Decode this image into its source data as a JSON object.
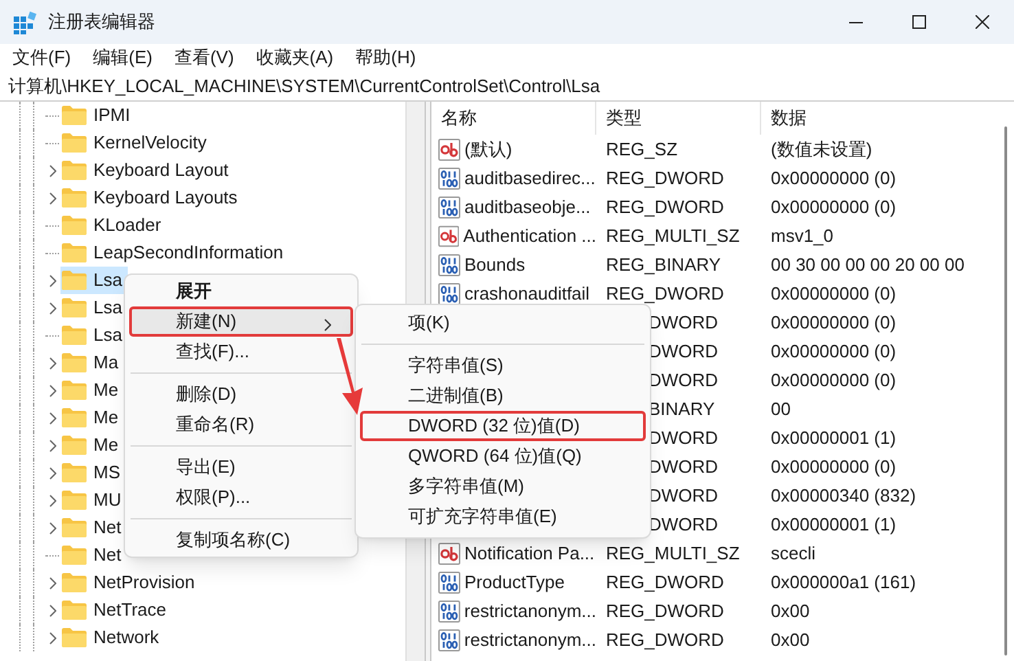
{
  "window": {
    "title": "注册表编辑器"
  },
  "menu_bar": [
    "文件(F)",
    "编辑(E)",
    "查看(V)",
    "收藏夹(A)",
    "帮助(H)"
  ],
  "address_bar": {
    "value": "计算机\\HKEY_LOCAL_MACHINE\\SYSTEM\\CurrentControlSet\\Control\\Lsa"
  },
  "tree": [
    {
      "label": "IPMI",
      "has_children": false,
      "selected": false
    },
    {
      "label": "KernelVelocity",
      "has_children": false,
      "selected": false
    },
    {
      "label": "Keyboard Layout",
      "has_children": true,
      "selected": false
    },
    {
      "label": "Keyboard Layouts",
      "has_children": true,
      "selected": false
    },
    {
      "label": "KLoader",
      "has_children": false,
      "selected": false
    },
    {
      "label": "LeapSecondInformation",
      "has_children": false,
      "selected": false
    },
    {
      "label": "Lsa",
      "has_children": true,
      "selected": true
    },
    {
      "label": "Lsa",
      "has_children": true,
      "selected": false
    },
    {
      "label": "Lsa",
      "has_children": false,
      "selected": false
    },
    {
      "label": "Ma",
      "has_children": true,
      "selected": false
    },
    {
      "label": "Me",
      "has_children": true,
      "selected": false
    },
    {
      "label": "Me",
      "has_children": true,
      "selected": false
    },
    {
      "label": "Me",
      "has_children": true,
      "selected": false
    },
    {
      "label": "MS",
      "has_children": true,
      "selected": false
    },
    {
      "label": "MU",
      "has_children": true,
      "selected": false
    },
    {
      "label": "Net",
      "has_children": true,
      "selected": false
    },
    {
      "label": "Net",
      "has_children": false,
      "selected": false
    },
    {
      "label": "NetProvision",
      "has_children": true,
      "selected": false
    },
    {
      "label": "NetTrace",
      "has_children": true,
      "selected": false
    },
    {
      "label": "Network",
      "has_children": true,
      "selected": false
    }
  ],
  "table": {
    "columns": [
      "名称",
      "类型",
      "数据"
    ],
    "rows": [
      {
        "kind": "string",
        "name": "(默认)",
        "type": "REG_SZ",
        "data": "(数值未设置)"
      },
      {
        "kind": "binary",
        "name": "auditbasedirec...",
        "type": "REG_DWORD",
        "data": "0x00000000 (0)"
      },
      {
        "kind": "binary",
        "name": "auditbaseobje...",
        "type": "REG_DWORD",
        "data": "0x00000000 (0)"
      },
      {
        "kind": "string",
        "name": "Authentication ...",
        "type": "REG_MULTI_SZ",
        "data": "msv1_0"
      },
      {
        "kind": "binary",
        "name": "Bounds",
        "type": "REG_BINARY",
        "data": "00 30 00 00 00 20 00 00"
      },
      {
        "kind": "binary",
        "name": "crashonauditfail",
        "type": "REG_DWORD",
        "data": "0x00000000 (0)"
      },
      {
        "kind": "covered",
        "type": "DWORD",
        "data": "0x00000000 (0)"
      },
      {
        "kind": "covered",
        "type": "DWORD",
        "data": "0x00000000 (0)"
      },
      {
        "kind": "covered",
        "type": "DWORD",
        "data": "0x00000000 (0)"
      },
      {
        "kind": "covered",
        "type": "BINARY",
        "data": "00"
      },
      {
        "kind": "covered",
        "type": "DWORD",
        "data": "0x00000001 (1)"
      },
      {
        "kind": "covered",
        "type": "DWORD",
        "data": "0x00000000 (0)"
      },
      {
        "kind": "covered",
        "type": "DWORD",
        "data": "0x00000340 (832)"
      },
      {
        "kind": "covered",
        "type": "DWORD",
        "data": "0x00000001 (1)"
      },
      {
        "kind": "string",
        "name": "Notification Pa...",
        "type": "REG_MULTI_SZ",
        "data": "scecli"
      },
      {
        "kind": "binary",
        "name": "ProductType",
        "type": "REG_DWORD",
        "data": "0x000000a1 (161)"
      },
      {
        "kind": "binary",
        "name": "restrictanonym...",
        "type": "REG_DWORD",
        "data": "0x00"
      },
      {
        "kind": "binary",
        "name": "restrictanonym...",
        "type": "REG_DWORD",
        "data": "0x00"
      }
    ]
  },
  "context_menu": [
    {
      "kind": "item",
      "label": "展开",
      "bold": true,
      "highlighted": false,
      "submenu": false
    },
    {
      "kind": "item",
      "label": "新建(N)",
      "bold": false,
      "highlighted": true,
      "submenu": true
    },
    {
      "kind": "item",
      "label": "查找(F)...",
      "bold": false,
      "highlighted": false,
      "submenu": false
    },
    {
      "kind": "separator"
    },
    {
      "kind": "item",
      "label": "删除(D)",
      "bold": false,
      "highlighted": false,
      "submenu": false
    },
    {
      "kind": "item",
      "label": "重命名(R)",
      "bold": false,
      "highlighted": false,
      "submenu": false
    },
    {
      "kind": "separator"
    },
    {
      "kind": "item",
      "label": "导出(E)",
      "bold": false,
      "highlighted": false,
      "submenu": false
    },
    {
      "kind": "item",
      "label": "权限(P)...",
      "bold": false,
      "highlighted": false,
      "submenu": false
    },
    {
      "kind": "separator"
    },
    {
      "kind": "item",
      "label": "复制项名称(C)",
      "bold": false,
      "highlighted": false,
      "submenu": false
    }
  ],
  "submenu": [
    {
      "kind": "item",
      "label": "项(K)",
      "highlighted": false
    },
    {
      "kind": "separator"
    },
    {
      "kind": "item",
      "label": "字符串值(S)",
      "highlighted": false
    },
    {
      "kind": "item",
      "label": "二进制值(B)",
      "highlighted": false
    },
    {
      "kind": "item",
      "label": "DWORD (32 位)值(D)",
      "highlighted": true
    },
    {
      "kind": "item",
      "label": "QWORD (64 位)值(Q)",
      "highlighted": false
    },
    {
      "kind": "item",
      "label": "多字符串值(M)",
      "highlighted": false
    },
    {
      "kind": "item",
      "label": "可扩充字符串值(E)",
      "highlighted": false
    }
  ]
}
